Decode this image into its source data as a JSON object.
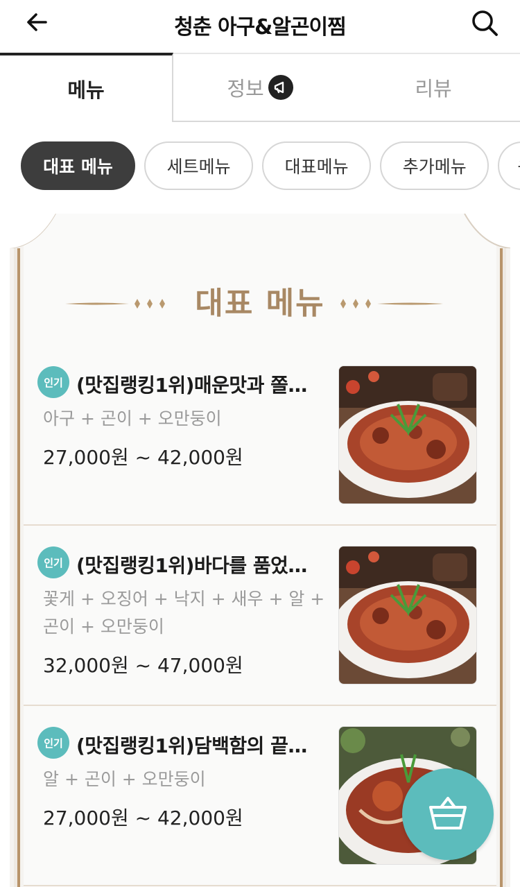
{
  "header": {
    "title": "청춘 아구&알곤이찜"
  },
  "tabs": [
    {
      "label": "메뉴"
    },
    {
      "label": "정보"
    },
    {
      "label": "리뷰"
    }
  ],
  "chips": [
    {
      "label": "대표 메뉴",
      "active": true
    },
    {
      "label": "세트메뉴"
    },
    {
      "label": "대표메뉴"
    },
    {
      "label": "추가메뉴"
    },
    {
      "label": "음"
    }
  ],
  "section": {
    "title": "대표 메뉴"
  },
  "items": [
    {
      "badge": "인기",
      "name": "(맛집랭킹1위)매운맛과 쫄…",
      "desc": "아구 + 곤이 + 오만둥이",
      "price": "27,000원 ~ 42,000원"
    },
    {
      "badge": "인기",
      "name": "(맛집랭킹1위)바다를 품었…",
      "desc": "꽃게 + 오징어 + 낙지 + 새우 + 알 + 곤이 + 오만둥이",
      "price": "32,000원 ~ 47,000원"
    },
    {
      "badge": "인기",
      "name": "(맛집랭킹1위)담백함의 끝…",
      "desc": "알 + 곤이 + 오만둥이",
      "price": "27,000원 ~ 42,000원"
    }
  ],
  "colors": {
    "accent": "#5cbcbc",
    "gold": "#a88864",
    "chip_active": "#3d3d3d"
  },
  "icons": {
    "back": "arrow-left-icon",
    "search": "search-icon",
    "info_badge": "megaphone-icon",
    "cart": "shopping-basket-icon"
  }
}
